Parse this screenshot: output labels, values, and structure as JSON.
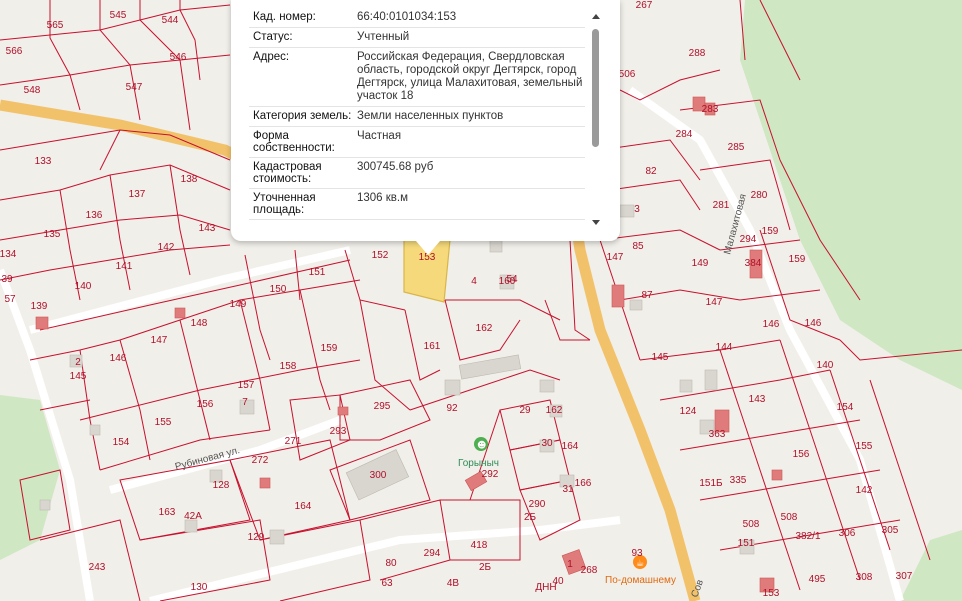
{
  "popup": {
    "rows": [
      {
        "key": "Кад. номер:",
        "value": "66:40:0101034:153"
      },
      {
        "key": "Статус:",
        "value": "Учтенный"
      },
      {
        "key": "Адрес:",
        "value": "Российская Федерация, Свердловская область, городской округ Дегтярск, город Дегтярск, улица Малахитовая, земельный участок 18"
      },
      {
        "key": "Категория земель:",
        "value": "Земли населенных пунктов"
      },
      {
        "key": "Форма собственности:",
        "value": "Частная"
      },
      {
        "key": "Кадастровая стоимость:",
        "value": "300745.68 руб"
      },
      {
        "key": "Уточненная площадь:",
        "value": "1306 кв.м"
      }
    ]
  },
  "map": {
    "selected_plot": "153",
    "streets": [
      "Рубиновая ул.",
      "Малахитовая",
      "Сов"
    ],
    "pois": [
      "Горыныч",
      "По-домашнему"
    ],
    "colors": {
      "plot_border": "#c8102e",
      "selected_fill": "#f5d97a",
      "road": "#f2c26b",
      "forest": "#cfe7c3",
      "building": "#d9d6cf",
      "registered_building": "#e07b7b"
    }
  },
  "plot_labels": [
    "565",
    "545",
    "544",
    "566",
    "546",
    "548",
    "547",
    "133",
    "138",
    "137",
    "136",
    "135",
    "142",
    "143",
    "134",
    "141",
    "140",
    "139",
    "148",
    "149",
    "150",
    "151",
    "152",
    "153",
    "4",
    "160",
    "162",
    "161",
    "147",
    "146",
    "145",
    "2",
    "158",
    "159",
    "157",
    "7",
    "156",
    "155",
    "154",
    "295",
    "293",
    "92",
    "29",
    "162",
    "30",
    "164",
    "31",
    "166",
    "271",
    "272",
    "128",
    "163",
    "42А",
    "300",
    "292",
    "164",
    "290",
    "2Б",
    "129",
    "418",
    "294",
    "80",
    "63",
    "2Б",
    "4В",
    "243",
    "130",
    "267",
    "288",
    "283",
    "506",
    "284",
    "285",
    "82",
    "3",
    "85",
    "147",
    "87",
    "281",
    "280",
    "149",
    "159",
    "294",
    "384",
    "159",
    "147",
    "146",
    "146",
    "144",
    "140",
    "145",
    "143",
    "124",
    "363",
    "154",
    "155",
    "156",
    "335",
    "151Б",
    "142",
    "305",
    "508",
    "508",
    "151",
    "382/1",
    "306",
    "495",
    "307",
    "308",
    "93",
    "268",
    "1",
    "153",
    "ДНН",
    "39",
    "57",
    "54",
    "40",
    "9"
  ]
}
